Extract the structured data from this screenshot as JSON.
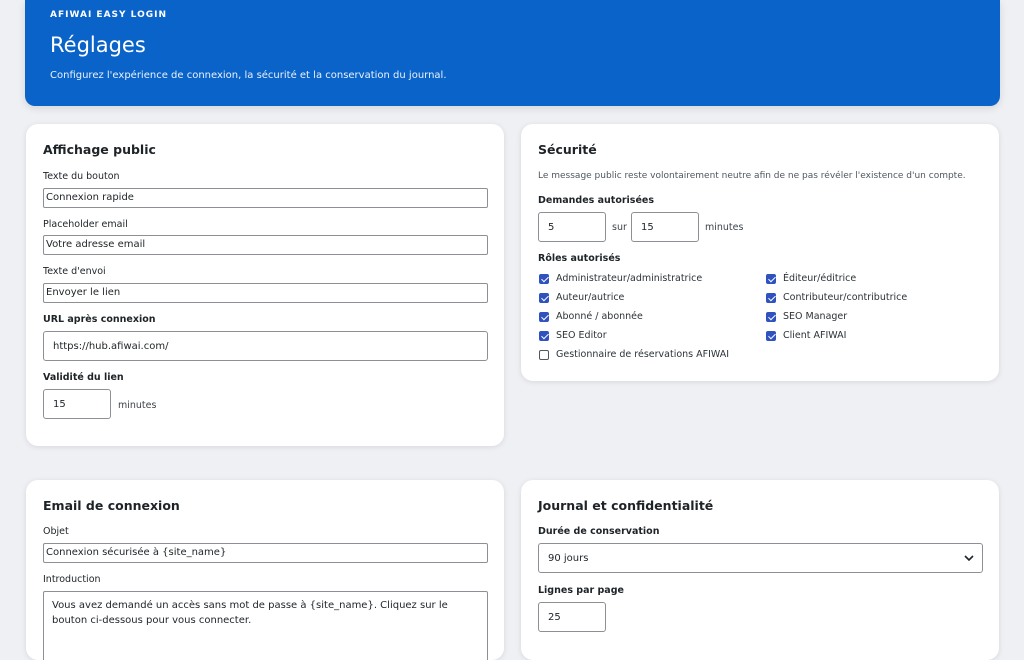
{
  "header": {
    "eyebrow": "AFIWAI EASY LOGIN",
    "title": "Réglages",
    "subtitle": "Configurez l'expérience de connexion, la sécurité et la conservation du journal."
  },
  "public_display": {
    "title": "Affichage public",
    "button_text_label": "Texte du bouton",
    "button_text_value": "Connexion rapide",
    "email_placeholder_label": "Placeholder email",
    "email_placeholder_value": "Votre adresse email",
    "send_text_label": "Texte d'envoi",
    "send_text_value": "Envoyer le lien",
    "redirect_url_label": "URL après connexion",
    "redirect_url_value": "https://hub.afiwai.com/",
    "link_validity_label": "Validité du lien",
    "link_validity_value": "15",
    "link_validity_unit": "minutes"
  },
  "security": {
    "title": "Sécurité",
    "note": "Le message public reste volontairement neutre afin de ne pas révéler l'existence d'un compte.",
    "rate_label": "Demandes autorisées",
    "rate_count": "5",
    "rate_sep": "sur",
    "rate_window": "15",
    "rate_unit": "minutes",
    "roles_label": "Rôles autorisés",
    "roles": [
      {
        "label": "Administrateur/administratrice",
        "checked": true
      },
      {
        "label": "Éditeur/éditrice",
        "checked": true
      },
      {
        "label": "Auteur/autrice",
        "checked": true
      },
      {
        "label": "Contributeur/contributrice",
        "checked": true
      },
      {
        "label": "Abonné / abonnée",
        "checked": true
      },
      {
        "label": "SEO Manager",
        "checked": true
      },
      {
        "label": "SEO Editor",
        "checked": true
      },
      {
        "label": "Client AFIWAI",
        "checked": true
      },
      {
        "label": "Gestionnaire de réservations AFIWAI",
        "checked": false
      }
    ]
  },
  "login_email": {
    "title": "Email de connexion",
    "subject_label": "Objet",
    "subject_value": "Connexion sécurisée à {site_name}",
    "intro_label": "Introduction",
    "intro_value": "Vous avez demandé un accès sans mot de passe à {site_name}. Cliquez sur le bouton ci-dessous pour vous connecter."
  },
  "log": {
    "title": "Journal et confidentialité",
    "retention_label": "Durée de conservation",
    "retention_value": "90 jours",
    "rows_label": "Lignes par page",
    "rows_value": "25"
  }
}
